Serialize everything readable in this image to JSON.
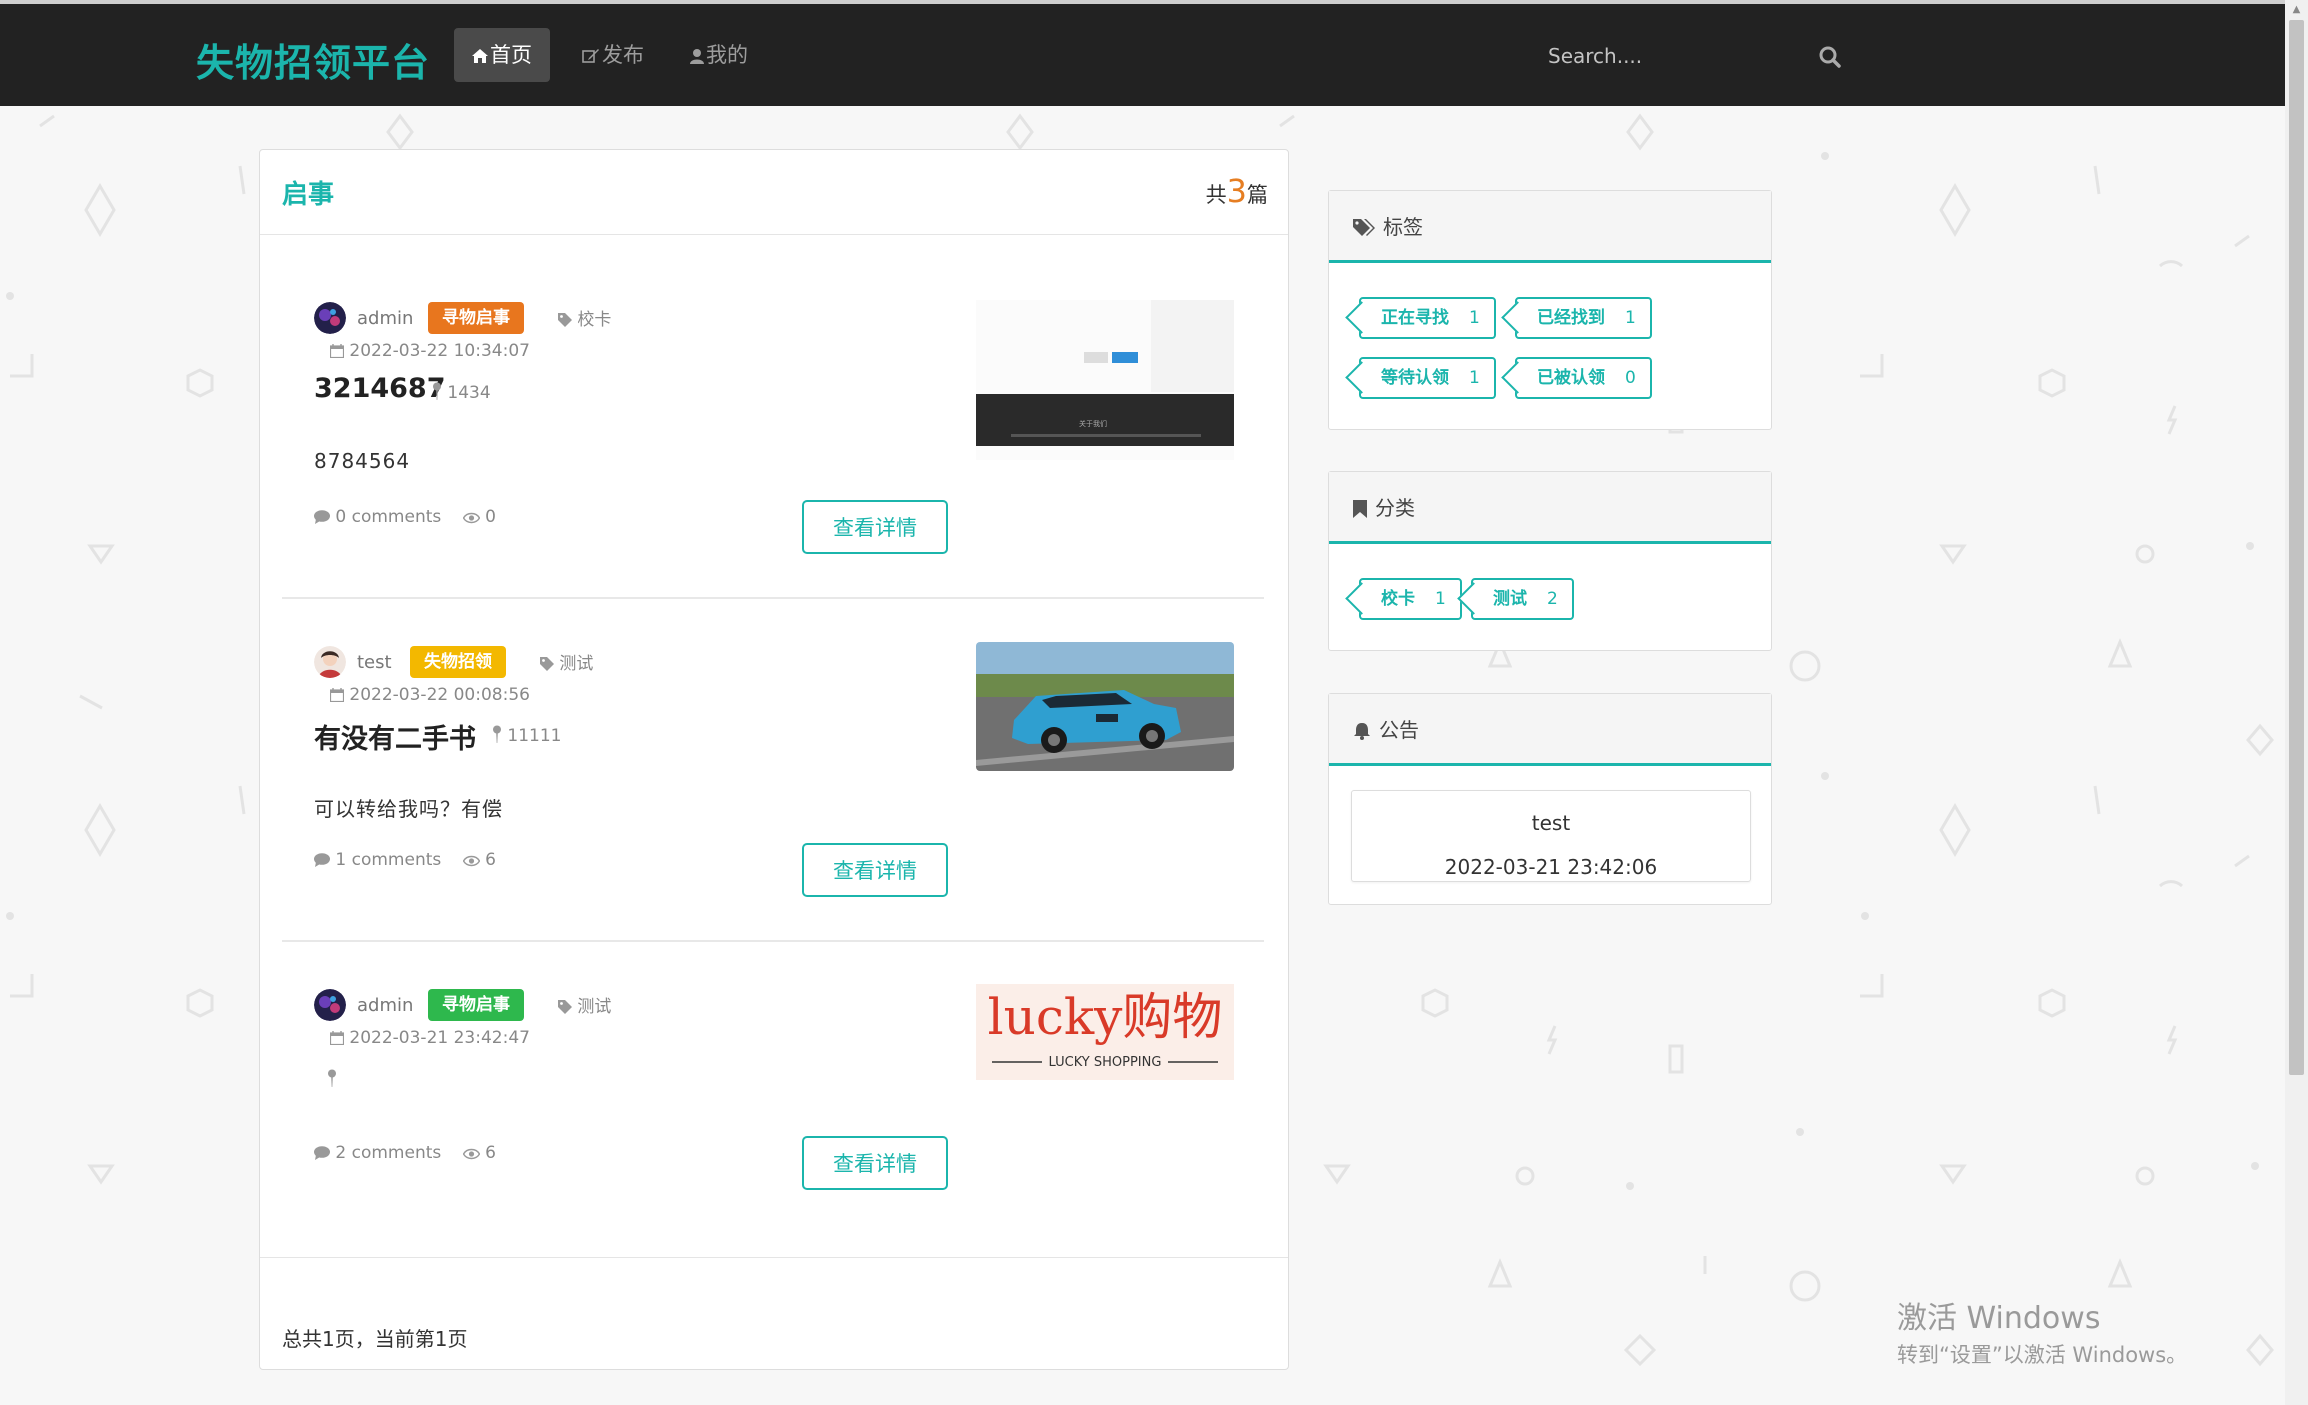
{
  "colors": {
    "accent": "#1bb5ac",
    "navbar_bg": "#222222",
    "orange": "#e67e22",
    "yellow": "#f0b400",
    "green": "#2eb84d"
  },
  "navbar": {
    "brand": "失物招领平台",
    "items": [
      {
        "label": "首页",
        "icon": "home-icon",
        "active": true
      },
      {
        "label": "发布",
        "icon": "edit-icon",
        "active": false
      },
      {
        "label": "我的",
        "icon": "user-icon",
        "active": false
      }
    ],
    "search_placeholder": "Search...."
  },
  "main": {
    "title": "启事",
    "count_prefix": "共",
    "count": "3",
    "count_suffix": "篇",
    "articles": [
      {
        "author": "admin",
        "badge": "寻物启事",
        "badge_color": "#e8761e",
        "tag": "校卡",
        "date": "2022-03-22 10:34:07",
        "title": "3214687",
        "location": "1434",
        "summary": "8784564",
        "comments": "0 comments",
        "views": "0",
        "button": "查看详情",
        "thumb_caption": "关于我们"
      },
      {
        "author": "test",
        "badge": "失物招领",
        "badge_color": "#f3b800",
        "tag": "测试",
        "date": "2022-03-22 00:08:56",
        "title": "有没有二手书",
        "location": "11111",
        "summary": "可以转给我吗？有偿",
        "comments": "1 comments",
        "views": "6",
        "button": "查看详情"
      },
      {
        "author": "admin",
        "badge": "寻物启事",
        "badge_color": "#2eb84d",
        "tag": "测试",
        "date": "2022-03-21 23:42:47",
        "title": "",
        "location": "",
        "summary": "",
        "comments": "2 comments",
        "views": "6",
        "button": "查看详情",
        "thumb_text": "lucky购物",
        "thumb_sub": "LUCKY SHOPPING"
      }
    ],
    "pager": "总共1页，当前第1页"
  },
  "sidebar": {
    "tags": {
      "title": "标签",
      "items": [
        {
          "label": "正在寻找",
          "count": "1"
        },
        {
          "label": "已经找到",
          "count": "1"
        },
        {
          "label": "等待认领",
          "count": "1"
        },
        {
          "label": "已被认领",
          "count": "0"
        }
      ]
    },
    "categories": {
      "title": "分类",
      "items": [
        {
          "label": "校卡",
          "count": "1"
        },
        {
          "label": "测试",
          "count": "2"
        }
      ]
    },
    "notice": {
      "title": "公告",
      "item_title": "test",
      "item_time": "2022-03-21 23:42:06"
    }
  },
  "watermark": {
    "line1": "激活 Windows",
    "line2": "转到“设置”以激活 Windows。"
  }
}
